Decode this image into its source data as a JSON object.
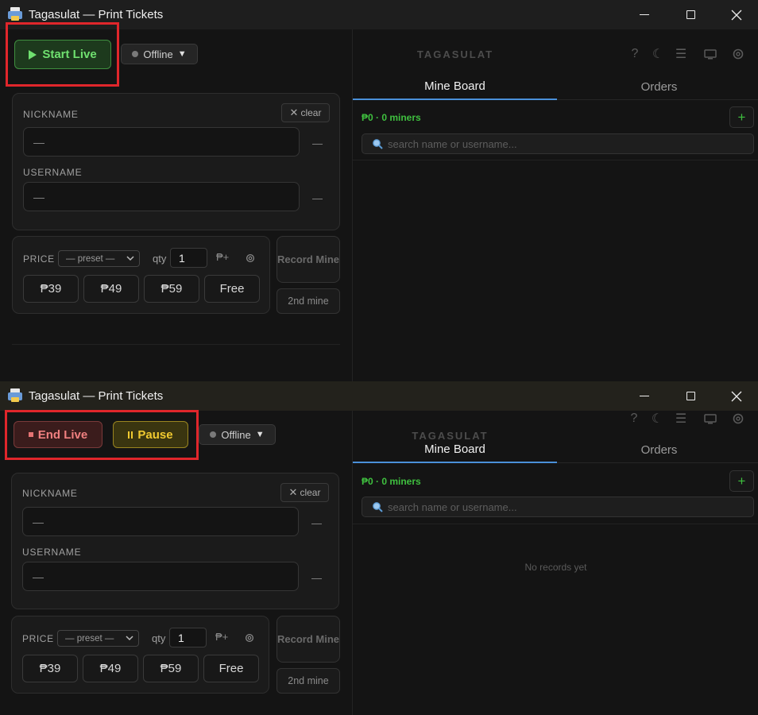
{
  "app": {
    "title": "Tagasulat — Print Tickets",
    "brand": "TAGASULAT"
  },
  "window1": {
    "start_label": "Start Live",
    "status_label": "Offline"
  },
  "window2": {
    "end_label": "End Live",
    "pause_label": "Pause",
    "status_label": "Offline",
    "empty_label": "No records yet"
  },
  "form": {
    "nickname_label": "NICKNAME",
    "username_label": "USERNAME",
    "nickname_value": "—",
    "username_value": "—",
    "nickname_dash": "—",
    "username_dash": "—",
    "clear_label": "clear"
  },
  "price": {
    "label": "PRICE",
    "preset_label": "— preset —",
    "qty_label": "qty",
    "qty_value": "1",
    "peso_plus": "₱+",
    "buttons": [
      "₱39",
      "₱49",
      "₱59",
      "Free"
    ],
    "record_label": "Record Mine",
    "second_label": "2nd mine"
  },
  "board": {
    "tabs": [
      "Mine Board",
      "Orders"
    ],
    "summary": "₱0 · 0 miners",
    "search_placeholder": "search name or username...",
    "add_label": "+"
  },
  "icons": {
    "header": [
      "help-icon",
      "moon-icon",
      "menu-icon",
      "monitor-icon",
      "gear-icon"
    ]
  },
  "colors": {
    "accent_green": "#3fc03f",
    "tab_underline": "#4a90d9",
    "highlight_red": "#e0262b",
    "end_red": "#f08080",
    "pause_yellow": "#f0c930"
  }
}
